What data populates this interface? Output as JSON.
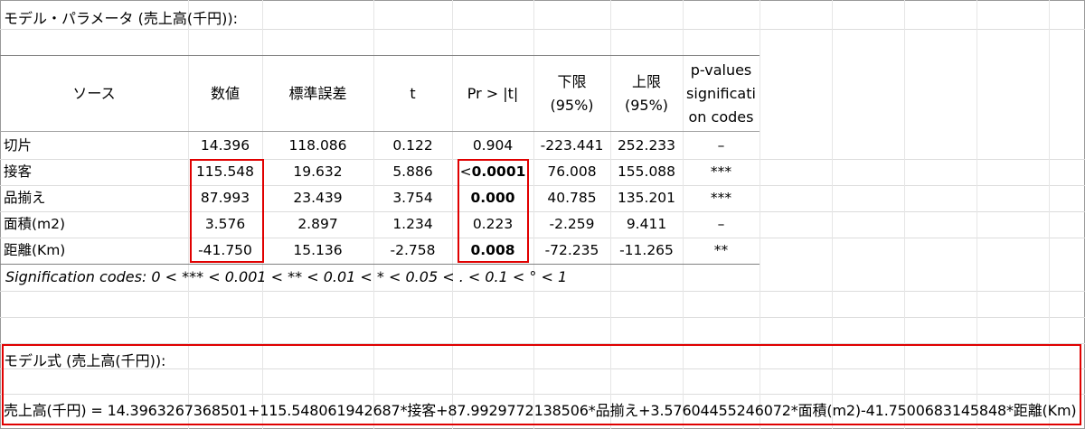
{
  "title": "モデル・パラメータ (売上高(千円)):",
  "headers": {
    "source": "ソース",
    "value": "数値",
    "std_error": "標準誤差",
    "t": "t",
    "pr": "Pr > |t|",
    "lower": [
      "下限",
      "(95%)"
    ],
    "upper": [
      "上限",
      "(95%)"
    ],
    "pvalues": [
      "p-values",
      "significati",
      "on codes"
    ]
  },
  "rows": [
    {
      "source": "切片",
      "value": "14.396",
      "std_error": "118.086",
      "t": "0.122",
      "pr": "0.904",
      "pr_bold": false,
      "lower": "-223.441",
      "upper": "252.233",
      "code": "–"
    },
    {
      "source": "接客",
      "value": "115.548",
      "std_error": "19.632",
      "t": "5.886",
      "pr_prefix": "<",
      "pr": "0.0001",
      "pr_bold": true,
      "lower": "76.008",
      "upper": "155.088",
      "code": "***"
    },
    {
      "source": "品揃え",
      "value": "87.993",
      "std_error": "23.439",
      "t": "3.754",
      "pr": "0.000",
      "pr_bold": true,
      "lower": "40.785",
      "upper": "135.201",
      "code": "***"
    },
    {
      "source": "面積(m2)",
      "value": "3.576",
      "std_error": "2.897",
      "t": "1.234",
      "pr": "0.223",
      "pr_bold": false,
      "lower": "-2.259",
      "upper": "9.411",
      "code": "–"
    },
    {
      "source": "距離(Km)",
      "value": "-41.750",
      "std_error": "15.136",
      "t": "-2.758",
      "pr": "0.008",
      "pr_bold": true,
      "lower": "-72.235",
      "upper": "-11.265",
      "code": "**"
    }
  ],
  "signification_codes": "Signification codes: 0 < *** < 0.001 < ** < 0.01 < * < 0.05 < . < 0.1 < °   < 1",
  "model_equation_title": "モデル式 (売上高(千円)):",
  "model_equation": "売上高(千円) = 14.3963267368501+115.548061942687*接客+87.9929772138506*品揃え+3.57604455246072*面積(m2)-41.7500683145848*距離(Km)",
  "colors": {
    "highlight_border": "#e00000",
    "gridline": "#dcdcdc"
  }
}
